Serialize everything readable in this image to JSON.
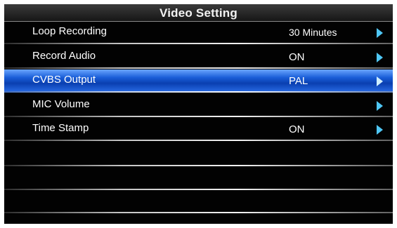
{
  "menu": {
    "title": "Video Setting",
    "items": [
      {
        "label": "Loop Recording",
        "value": "30 Minutes",
        "selected": false,
        "arrow_icon": "chevron-right-icon"
      },
      {
        "label": "Record Audio",
        "value": "ON",
        "selected": false,
        "arrow_icon": "chevron-right-icon"
      },
      {
        "label": "CVBS Output",
        "value": "PAL",
        "selected": true,
        "arrow_icon": "chevron-right-icon"
      },
      {
        "label": "MIC Volume",
        "value": "",
        "selected": false,
        "arrow_icon": "chevron-right-icon"
      },
      {
        "label": "Time Stamp",
        "value": "ON",
        "selected": false,
        "arrow_icon": "chevron-right-icon"
      }
    ]
  },
  "colors": {
    "background": "#020202",
    "selected_row": "#1a5ed8",
    "arrow": "#4fc7f5",
    "text": "#ffffff"
  }
}
